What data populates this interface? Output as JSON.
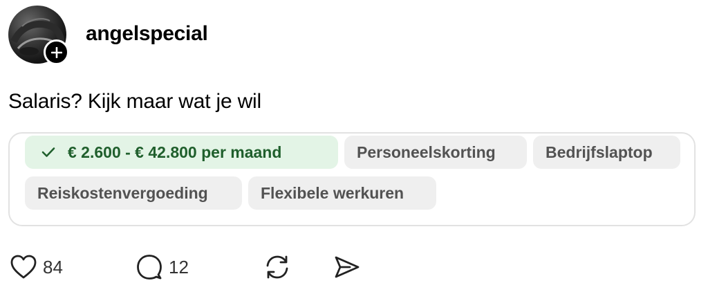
{
  "post": {
    "username": "angelspecial",
    "text": "Salaris? Kijk maar wat je wil"
  },
  "job_card": {
    "chips": {
      "salary": "€ 2.600 - € 42.800 per maand",
      "employee_discount": "Personeelskorting",
      "company_laptop": "Bedrijfslaptop",
      "travel_allowance": "Reiskostenvergoeding",
      "flexible_hours": "Flexibele werkuren"
    },
    "colors": {
      "salary_bg": "#e3f4e6",
      "salary_text": "#1f5f2c",
      "chip_bg": "#efefef"
    }
  },
  "actions": {
    "likes": "84",
    "replies": "12",
    "icons": [
      "heart-icon",
      "comment-icon",
      "repost-icon",
      "share-icon"
    ]
  }
}
